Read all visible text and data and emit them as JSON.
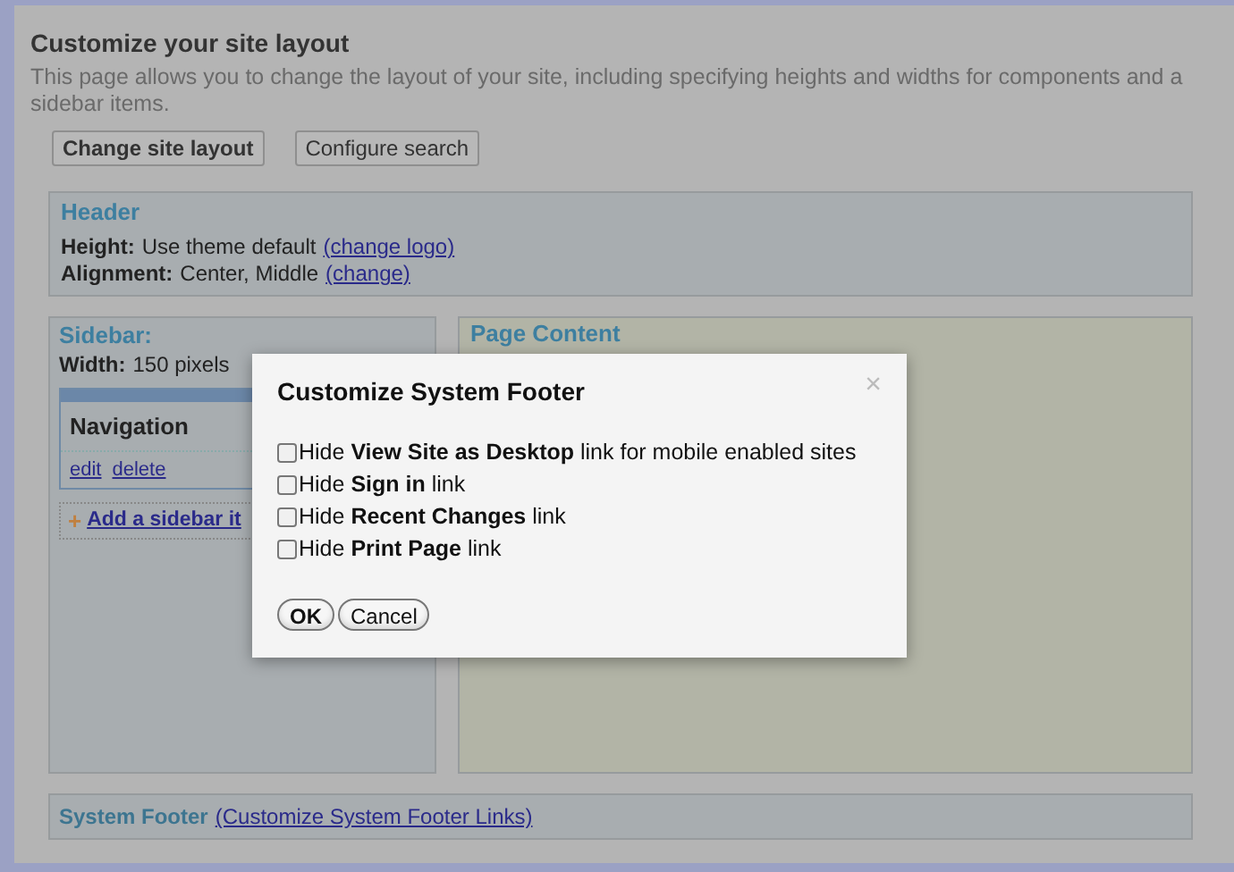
{
  "page": {
    "title": "Customize your site layout",
    "description_lines": [
      "This page allows you to change the layout of your site, including specifying heights and widths for components and a",
      "sidebar items."
    ],
    "buttons": [
      "Change site layout",
      "Configure search"
    ]
  },
  "header_panel": {
    "title": "Header",
    "rows": [
      {
        "label": "Height:",
        "value": "Use theme default",
        "link": "(change logo)"
      },
      {
        "label": "Alignment:",
        "value": "Center, Middle",
        "link": "(change)"
      }
    ]
  },
  "sidebar_panel": {
    "title": "Sidebar:",
    "width_label": "Width:",
    "width_value": "150 pixels",
    "widget": {
      "title": "Navigation",
      "links": [
        "edit",
        "delete"
      ]
    },
    "add_icon": "+",
    "add_link": "Add a sidebar it"
  },
  "content_panel": {
    "title": "Page Content"
  },
  "footer_panel": {
    "title": "System Footer",
    "link": "(Customize System Footer Links)"
  },
  "dialog": {
    "title": "Customize System Footer",
    "close": "×",
    "options": [
      {
        "label": "Hide **View Site as Desktop** link for mobile enabled sites",
        "checked": false
      },
      {
        "label": "Hide **Sign in** link",
        "checked": false
      },
      {
        "label": "Hide **Recent Changes** link",
        "checked": false
      },
      {
        "label": "Hide **Print Page** link",
        "checked": false
      }
    ],
    "buttons": [
      "OK",
      "Cancel"
    ]
  }
}
